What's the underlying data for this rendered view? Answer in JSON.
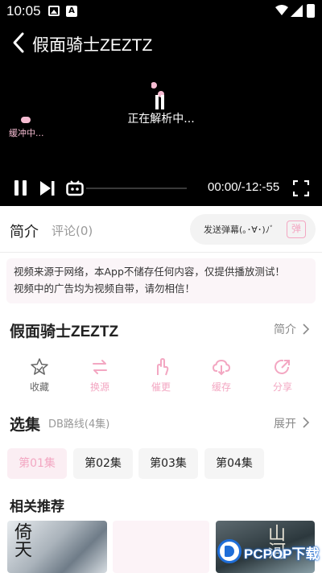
{
  "statusbar": {
    "time": "10:05",
    "left_icons": [
      "image-icon",
      "a-app-icon"
    ],
    "right_icons": [
      "wifi-icon",
      "signal-icon",
      "battery-icon"
    ]
  },
  "player": {
    "title": "假面骑士ZEZTZ",
    "parsing_text": "正在解析中...",
    "buffering_text": "缓冲中...",
    "time_display": "00:00/-12:-55",
    "progress_fraction": 0.0
  },
  "tabs": {
    "intro": "简介",
    "comments": "评论(0)",
    "danmu_placeholder": "发送弹幕(｡･∀･)ﾉﾞ",
    "danmu_send_label": "弹"
  },
  "notice": {
    "line1": "视频来源于网络，本App不储存任何内容，仅提供播放测试！",
    "line2": "视频中的广告均为视频自带，请勿相信！"
  },
  "detail": {
    "title": "假面骑士ZEZTZ",
    "intro_link": "简介"
  },
  "actions": [
    {
      "label": "收藏",
      "icon": "star-icon"
    },
    {
      "label": "换源",
      "icon": "swap-icon"
    },
    {
      "label": "催更",
      "icon": "hand-icon"
    },
    {
      "label": "缓存",
      "icon": "cloud-download-icon"
    },
    {
      "label": "分享",
      "icon": "share-icon"
    }
  ],
  "episodes": {
    "title": "选集",
    "route": "DB路线(4集)",
    "expand": "展开",
    "items": [
      "第01集",
      "第02集",
      "第03集",
      "第04集"
    ],
    "selected_index": 0
  },
  "recommend": {
    "title": "相关推荐"
  },
  "watermark": {
    "text": "PCPOP下载"
  },
  "colors": {
    "accent_pink": "#f3a7c2",
    "player_bg": "#000000",
    "notice_bg": "#fbf5f8"
  }
}
